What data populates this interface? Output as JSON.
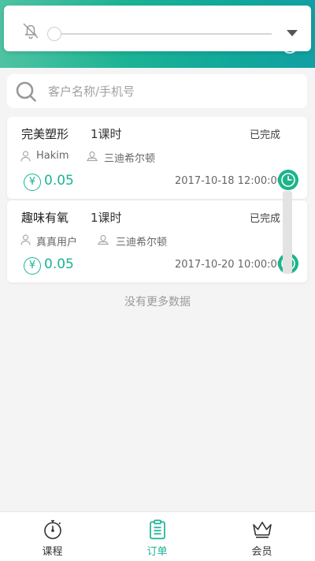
{
  "volume_panel": {
    "icon": "bell-off-icon",
    "level": 0,
    "expand_icon": "chevron-down-icon"
  },
  "search": {
    "placeholder": "客户名称/手机号",
    "value": ""
  },
  "orders": [
    {
      "course": "完美塑形",
      "hours": "1课时",
      "status": "已完成",
      "customer": "Hakim",
      "store": "三迪希尔顿",
      "currency": "¥",
      "price": "0.05",
      "time": "2017-10-18 12:00:00"
    },
    {
      "course": "趣味有氧",
      "hours": "1课时",
      "status": "已完成",
      "customer": "真真用户",
      "store": "三迪希尔顿",
      "currency": "¥",
      "price": "0.05",
      "time": "2017-10-20 10:00:00"
    }
  ],
  "footer_text": "没有更多数据",
  "tabs": [
    {
      "label": "课程",
      "icon": "stopwatch-icon",
      "active": false
    },
    {
      "label": "订单",
      "icon": "clipboard-icon",
      "active": true
    },
    {
      "label": "会员",
      "icon": "crown-icon",
      "active": false
    }
  ],
  "colors": {
    "accent": "#1ab394",
    "header_gradient_start": "#4fc3a1",
    "header_gradient_end": "#12a0a4"
  }
}
